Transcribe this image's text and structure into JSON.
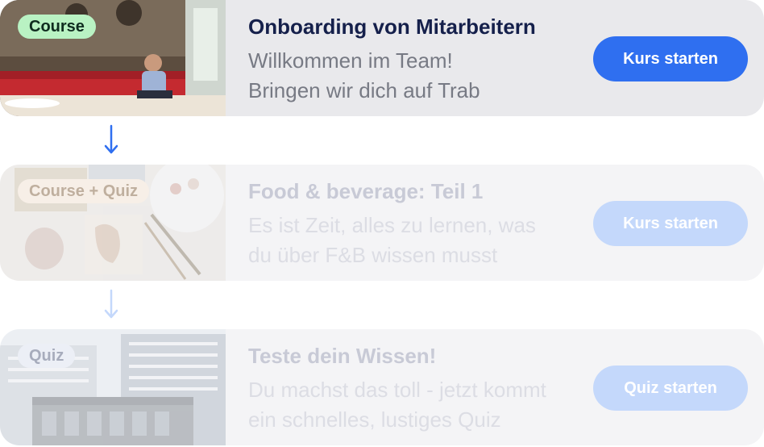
{
  "steps": [
    {
      "badge": "Course",
      "title": "Onboarding von Mitarbeitern",
      "desc_line1": "Willkommen im Team!",
      "desc_line2": "Bringen wir dich auf Trab",
      "button": "Kurs starten",
      "state": "active",
      "image": "restaurant-photo"
    },
    {
      "badge": "Course + Quiz",
      "title": "Food & beverage: Teil 1",
      "desc_line1": "Es ist Zeit, alles zu lernen, was",
      "desc_line2": "du über F&B wissen musst",
      "button": "Kurs starten",
      "state": "locked",
      "image": "art-supplies-photo"
    },
    {
      "badge": "Quiz",
      "title": "Teste dein Wissen!",
      "desc_line1": "Du machst das toll - jetzt kommt",
      "desc_line2": "ein schnelles, lustiges Quiz",
      "button": "Quiz starten",
      "state": "locked",
      "image": "office-building-photo"
    }
  ],
  "connectors": [
    "arrow-down-icon",
    "arrow-down-icon"
  ],
  "colors": {
    "primary_button": "#2f6ff0",
    "title": "#15204b",
    "badge_course": "#b9f2c3",
    "badge_course_quiz": "#fde7cf",
    "badge_quiz": "#dfe6f7"
  }
}
